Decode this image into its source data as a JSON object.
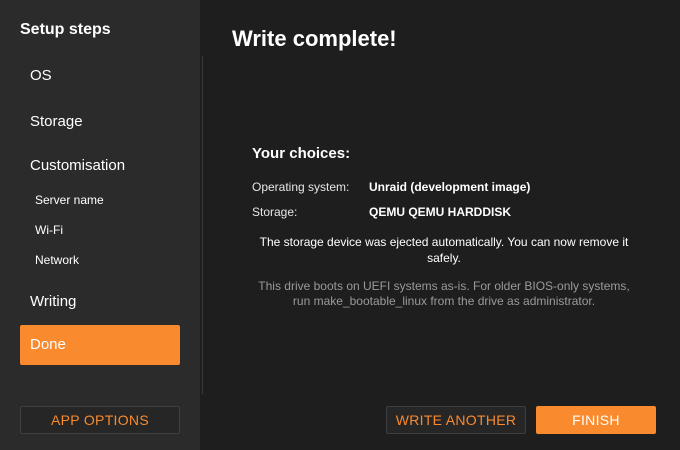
{
  "sidebar": {
    "title": "Setup steps",
    "steps": {
      "os": "OS",
      "storage": "Storage",
      "customisation": "Customisation",
      "server_name": "Server name",
      "wifi": "Wi-Fi",
      "network": "Network",
      "writing": "Writing",
      "done": "Done"
    },
    "active_step": "Done",
    "app_options_label": "APP OPTIONS"
  },
  "main": {
    "title": "Write complete!",
    "choices_heading": "Your choices:",
    "choices": [
      {
        "label": "Operating system:",
        "value": "Unraid (development image)"
      },
      {
        "label": "Storage:",
        "value": "QEMU QEMU HARDDISK"
      }
    ],
    "notice": "The storage device was ejected automatically. You can now remove it safely.",
    "hint": "This drive boots on UEFI systems as-is. For older BIOS-only systems, run make_bootable_linux from the drive as administrator."
  },
  "buttons": {
    "write_another": "WRITE ANOTHER",
    "finish": "FINISH"
  },
  "colors": {
    "accent": "#f98a2e",
    "sidebar_bg": "#2b2b2b",
    "main_bg": "#1e1e1e"
  }
}
